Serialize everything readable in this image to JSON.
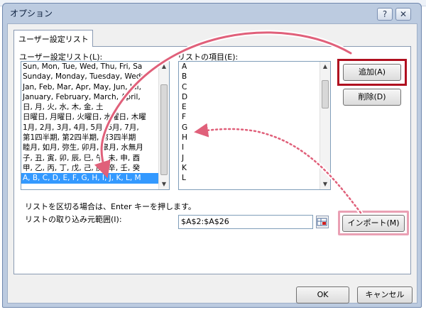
{
  "window": {
    "title": "オプション",
    "help_glyph": "?",
    "close_glyph": "✕"
  },
  "tab": {
    "label": "ユーザー設定リスト"
  },
  "custom_lists": {
    "label": "ユーザー設定リスト(L):",
    "items": [
      "Sun, Mon, Tue, Wed, Thu, Fri, Sa",
      "Sunday, Monday, Tuesday, Wedn",
      "Jan, Feb, Mar, Apr, May, Jun, Jul,",
      "January, February, March, April,",
      "日, 月, 火, 水, 木, 金, 土",
      "日曜日, 月曜日, 火曜日, 水曜日, 木曜",
      "1月, 2月, 3月, 4月, 5月, 6月, 7月,",
      "第1四半期, 第2四半期, 第3四半期",
      "睦月, 如月, 弥生, 卯月, 皐月, 水無月",
      "子, 丑, 寅, 卯, 辰, 巳, 午, 未, 申, 酉",
      "甲, 乙, 丙, 丁, 戊, 己, 庚, 辛, 壬, 癸",
      "A, B, C, D, E, F, G, H, I, J, K, L, M"
    ],
    "selected_index": 11
  },
  "list_entries": {
    "label": "リストの項目(E):",
    "items": [
      "A",
      "B",
      "C",
      "D",
      "E",
      "F",
      "G",
      "H",
      "I",
      "J",
      "K",
      "L"
    ]
  },
  "buttons": {
    "add": "追加(A)",
    "delete": "削除(D)",
    "import": "インポート(M)",
    "ok": "OK",
    "cancel": "キャンセル"
  },
  "hint_text": "リストを区切る場合は、Enter キーを押します。",
  "import_range": {
    "label": "リストの取り込み元範囲(I):",
    "value": "$A$2:$A$26"
  },
  "annotation_colors": {
    "red_box": "#b01020",
    "pink_box": "#eaa0b4",
    "arrow": "#e0607a"
  }
}
